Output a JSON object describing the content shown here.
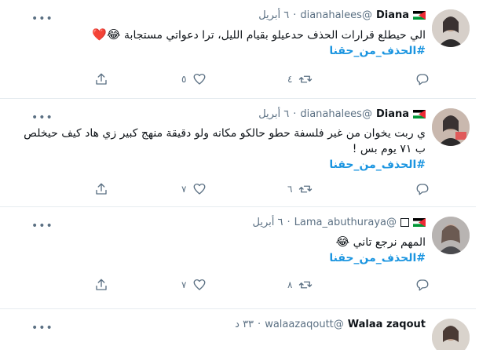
{
  "tweets": [
    {
      "name": "Diana",
      "handle": "@dianahalees",
      "dot": "·",
      "date": "٦ أبريل",
      "text": "الي حيطلع قرارات الحذف حدعيلو بقيام الليل، ترا دعواتي مستجابة",
      "emoji": "😂❤️",
      "hashtag": "#الحذف_من_حقنا",
      "replies": "",
      "retweets": "٤",
      "likes": "٥"
    },
    {
      "name": "Diana",
      "handle": "@dianahalees",
      "dot": "·",
      "date": "٦ أبريل",
      "text": "ي ربت يخوان من غير فلسفة حطو حالكو مكانه ولو دقيقة منهج كبير زي هاد كيف حيخلص ب ٧١ يوم بس !",
      "emoji": "",
      "hashtag": "#الحذف_من_حقنا",
      "replies": "",
      "retweets": "٦",
      "likes": "٧"
    },
    {
      "name": "Lama_abuthuraya",
      "handle": "@Lama_abuthuraya",
      "dot": "·",
      "date": "٦ أبريل",
      "text": "المهم نرجع تاني",
      "emoji": "😂",
      "hashtag": "#الحذف_من_حقنا",
      "replies": "",
      "retweets": "٨",
      "likes": "٧"
    },
    {
      "name": "Walaa zaqout",
      "handle": "@walaazaqoutt",
      "dot": "·",
      "date": "٣٣ د"
    }
  ],
  "colors": {
    "accent": "#1b95e0",
    "muted": "#5b7083",
    "text": "#0f1419",
    "divider": "#e6ecf0"
  },
  "icons": {
    "more": "more-dots-icon",
    "share": "share-icon",
    "like": "heart-icon",
    "retweet": "retweet-icon",
    "reply": "reply-icon",
    "flag": "palestine-flag-icon"
  }
}
